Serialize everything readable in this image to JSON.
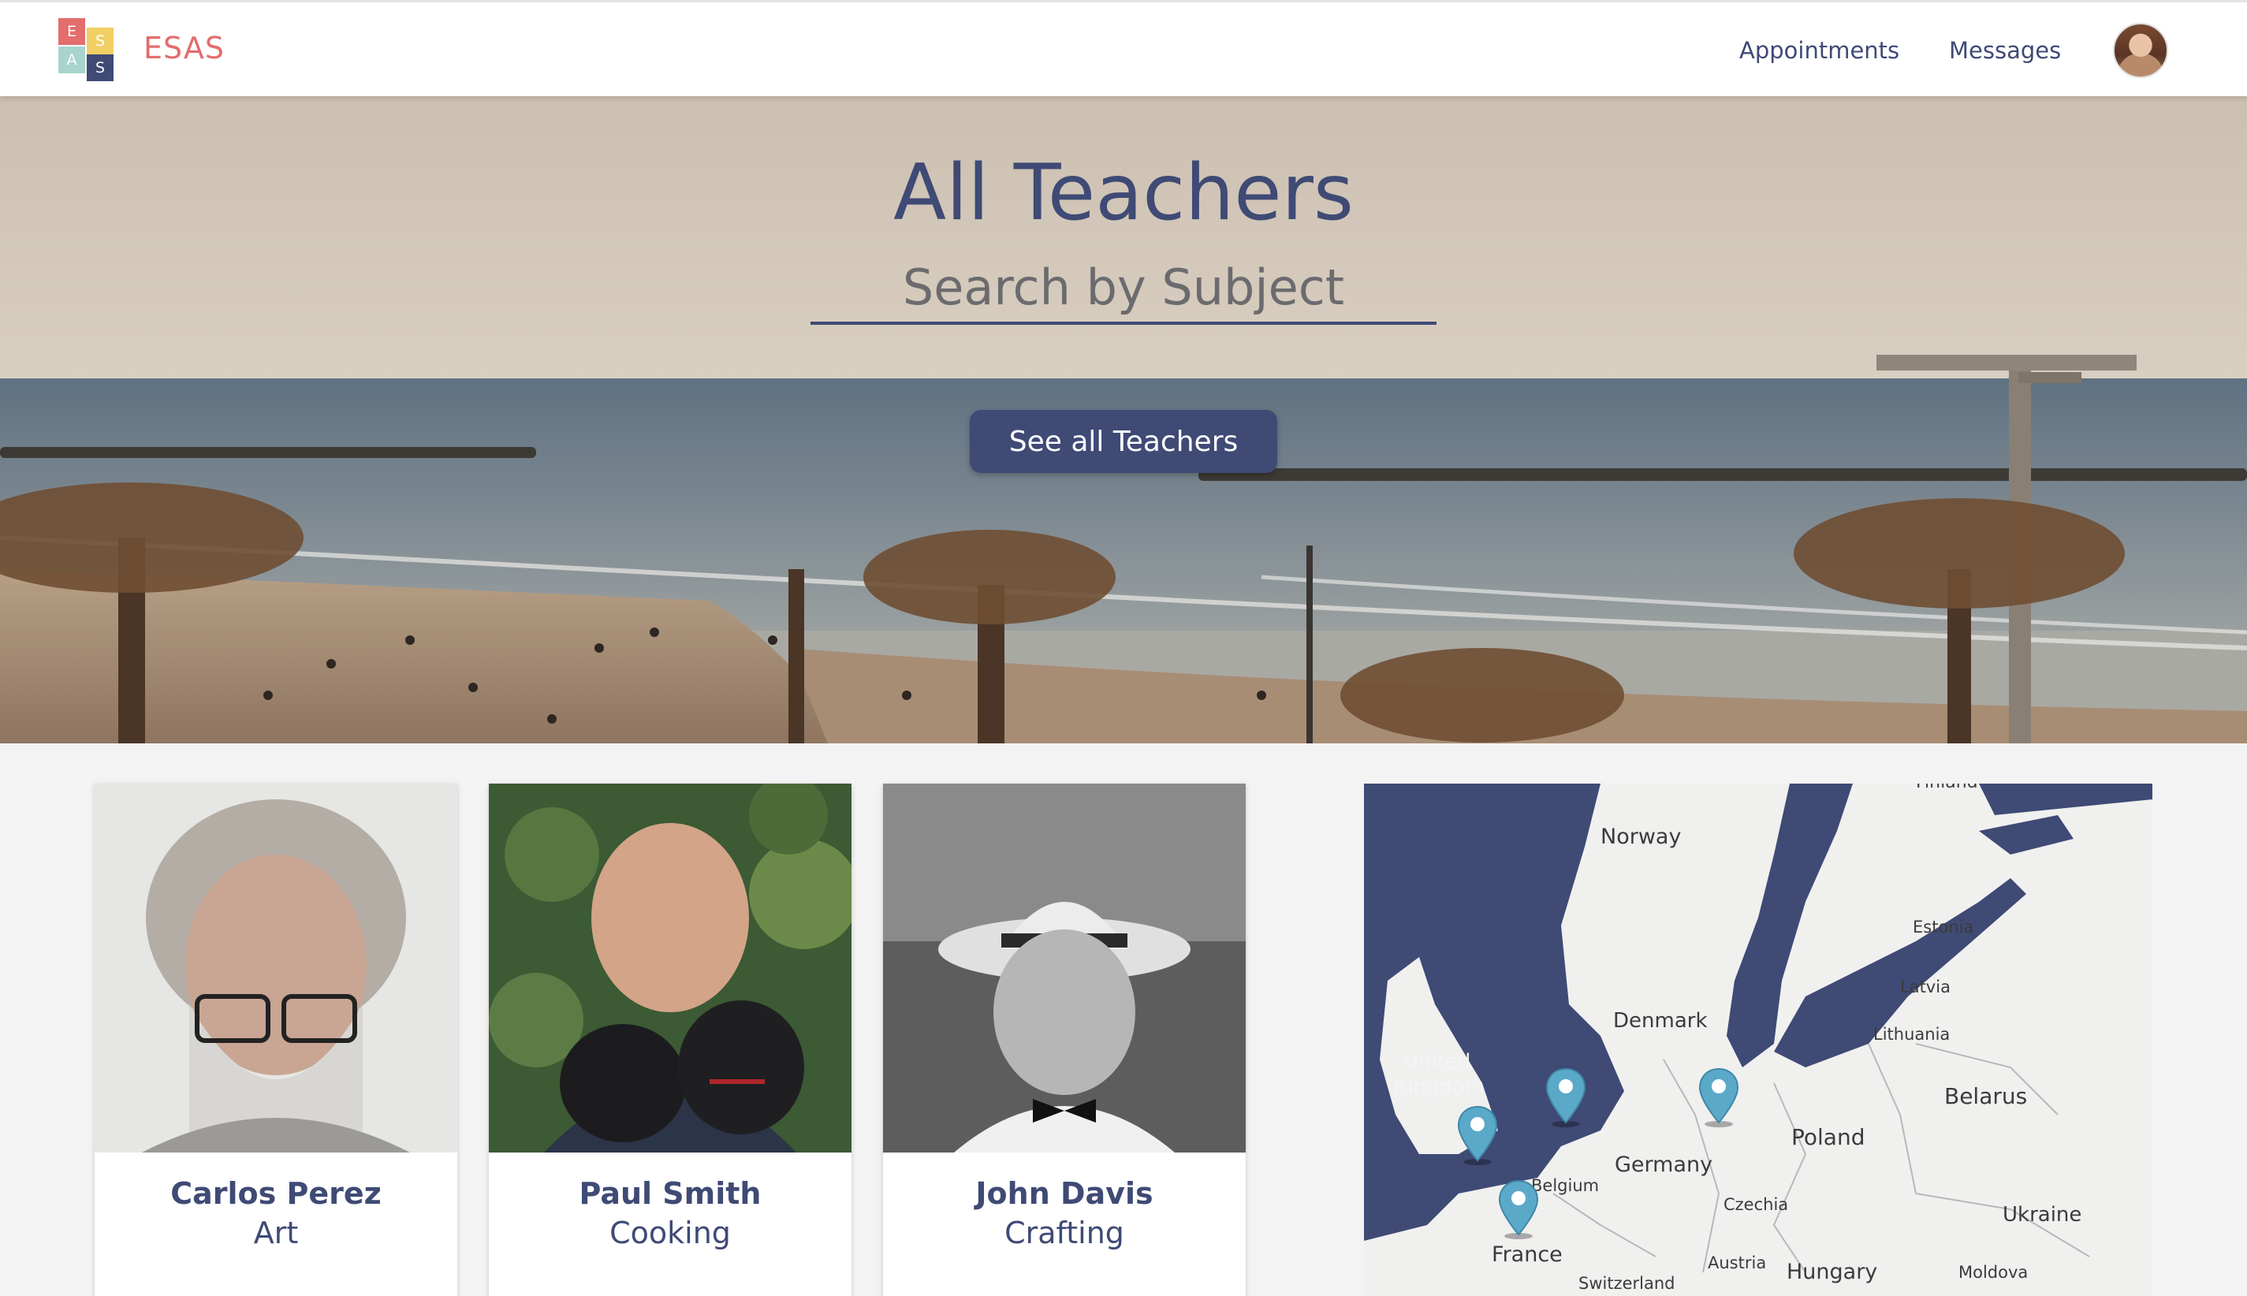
{
  "header": {
    "logo_letters": [
      "E",
      "S",
      "A",
      "S"
    ],
    "brand": "ESAS",
    "nav": {
      "appointments": "Appointments",
      "messages": "Messages"
    },
    "colors": {
      "brand": "#e46d6d",
      "primary": "#3f4a75"
    }
  },
  "hero": {
    "title": "All Teachers",
    "search": {
      "placeholder": "Search by Subject",
      "value": ""
    },
    "button_label": "See all Teachers"
  },
  "teachers": [
    {
      "name": "Carlos Perez",
      "subject": "Art"
    },
    {
      "name": "Paul Smith",
      "subject": "Cooking"
    },
    {
      "name": "John Davis",
      "subject": "Crafting"
    }
  ],
  "map": {
    "labels": {
      "finland": "Finland",
      "norway": "Norway",
      "estonia": "Estonia",
      "latvia": "Latvia",
      "lithuania": "Lithuania",
      "denmark": "Denmark",
      "uk_line1": "United",
      "uk_line2": "Kingdom",
      "belarus": "Belarus",
      "poland": "Poland",
      "germany": "Germany",
      "belgium": "Belgium",
      "czechia": "Czechia",
      "ukraine": "Ukraine",
      "france": "France",
      "austria": "Austria",
      "hungary": "Hungary",
      "moldova": "Moldova",
      "switzerland": "Switzerland"
    },
    "pins": 4,
    "pin_color": "#5aa9c9",
    "sea_color": "#3f4a75"
  }
}
